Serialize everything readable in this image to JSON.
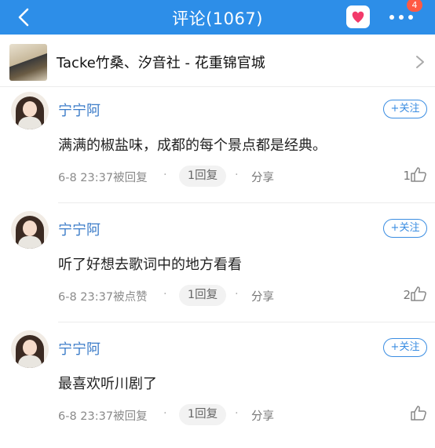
{
  "header": {
    "title": "评论(1067)",
    "badge_count": "4",
    "icons": {
      "back": "back-chevron-icon",
      "message": "message-heart-icon",
      "more": "more-dots-icon"
    },
    "color": "#2d8ee8"
  },
  "song": {
    "title": "Tacke竹桑、汐音社 - 花重锦官城",
    "icon": "chevron-right-icon"
  },
  "comments": [
    {
      "username": "宁宁阿",
      "follow_label": "+关注",
      "text": "满满的椒盐味，成都的每个景点都是经典。",
      "meta": "6-8 23:37被回复",
      "reply_label": "1回复",
      "share_label": "分享",
      "likes": "1"
    },
    {
      "username": "宁宁阿",
      "follow_label": "+关注",
      "text": "听了好想去歌词中的地方看看",
      "meta": "6-8 23:37被点赞",
      "reply_label": "1回复",
      "share_label": "分享",
      "likes": "2"
    },
    {
      "username": "宁宁阿",
      "follow_label": "+关注",
      "text": "最喜欢听川剧了",
      "meta": "6-8 23:37被回复",
      "reply_label": "1回复",
      "share_label": "分享",
      "likes": ""
    }
  ]
}
